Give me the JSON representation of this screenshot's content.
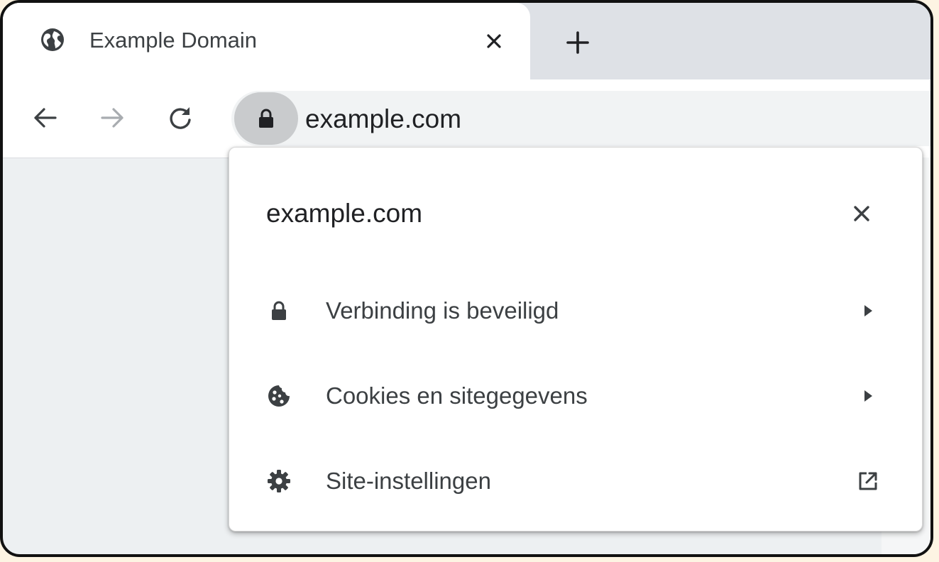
{
  "tab": {
    "title": "Example Domain",
    "favicon": "globe-icon",
    "close_icon": "close-icon"
  },
  "new_tab_icon": "plus-icon",
  "toolbar": {
    "back_icon": "arrow-left-icon",
    "forward_icon": "arrow-right-icon",
    "reload_icon": "reload-icon"
  },
  "omnibox": {
    "security_icon": "lock-icon",
    "url": "example.com"
  },
  "site_info": {
    "title": "example.com",
    "close_icon": "close-icon",
    "items": [
      {
        "label": "Verbinding is beveiligd",
        "icon": "lock-icon",
        "trailing": "triangle-right-icon"
      },
      {
        "label": "Cookies en sitegegevens",
        "icon": "cookie-icon",
        "trailing": "triangle-right-icon"
      },
      {
        "label": "Site-instellingen",
        "icon": "gear-icon",
        "trailing": "open-in-new-icon"
      }
    ]
  },
  "colors": {
    "icon": "#3c4043",
    "icon_disabled": "#a8acb0",
    "frame": "#dee1e6",
    "surface": "#ffffff"
  }
}
